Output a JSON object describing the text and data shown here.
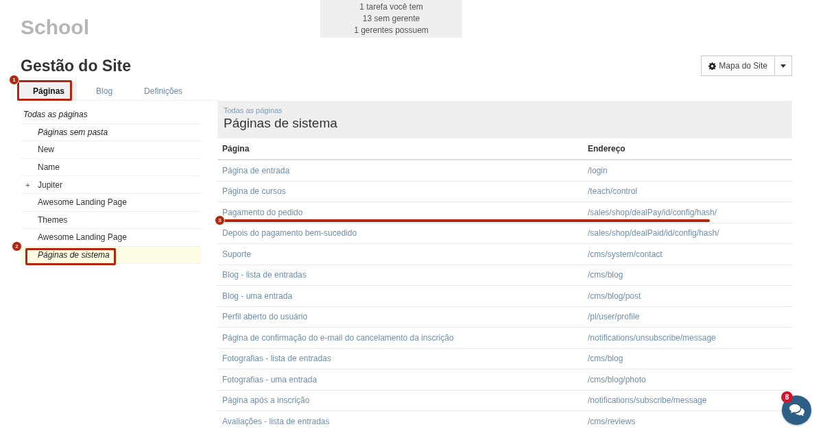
{
  "header": {
    "school": "School",
    "notifications": [
      "1 tarefa você tem",
      "13 sem gerente",
      "1 gerentes possuem"
    ]
  },
  "page_title": "Gestão do Site",
  "sitemap_button": {
    "label": "Mapa do Site"
  },
  "tabs": [
    {
      "label": "Páginas",
      "selected": true
    },
    {
      "label": "Blog",
      "selected": false
    },
    {
      "label": "Definições",
      "selected": false
    }
  ],
  "sidebar": {
    "items": [
      {
        "label": "Todas as páginas",
        "kind": "root",
        "selected": false
      },
      {
        "label": "Páginas sem pasta",
        "kind": "special",
        "selected": false
      },
      {
        "label": "New",
        "kind": "folder",
        "selected": false
      },
      {
        "label": "Name",
        "kind": "folder",
        "selected": false
      },
      {
        "label": "Jupiter",
        "kind": "folder",
        "toggle": "+",
        "selected": false
      },
      {
        "label": "Awesome Landing Page",
        "kind": "folder",
        "selected": false
      },
      {
        "label": "Themes",
        "kind": "folder",
        "selected": false
      },
      {
        "label": "Awesome Landing Page",
        "kind": "folder",
        "selected": false
      },
      {
        "label": "Páginas de sistema",
        "kind": "special",
        "selected": true
      }
    ]
  },
  "content": {
    "breadcrumb": "Todas as páginas",
    "title": "Páginas de sistema"
  },
  "table": {
    "columns": [
      "Página",
      "Endereço"
    ],
    "rows": [
      [
        "Página de entrada",
        "/login"
      ],
      [
        "Página de cursos",
        "/teach/control"
      ],
      [
        "Pagamento do pedido",
        "/sales/shop/dealPay/id/config/hash/"
      ],
      [
        "Depois do pagamento bem-sucedido",
        "/sales/shop/dealPaid/id/config/hash/"
      ],
      [
        "Suporte",
        "/cms/system/contact"
      ],
      [
        "Blog - lista de entradas",
        "/cms/blog"
      ],
      [
        "Blog - uma entrada",
        "/cms/blog/post"
      ],
      [
        "Perfil aberto do usuário",
        "/pl/user/profile"
      ],
      [
        "Página de confirmação do e-mail do cancelamento da inscrição",
        "/notifications/unsubscribe/message"
      ],
      [
        "Fotografias - lista de entradas",
        "/cms/blog"
      ],
      [
        "Fotografias - uma entrada",
        "/cms/blog/photo"
      ],
      [
        "Página após a inscrição",
        "/notifications/subscribe/message"
      ],
      [
        "Avaliações - lista de entradas",
        "/cms/reviews"
      ]
    ]
  },
  "annotations": [
    {
      "number": "1",
      "kind": "box"
    },
    {
      "number": "2",
      "kind": "box"
    },
    {
      "number": "3",
      "kind": "line"
    }
  ],
  "chat": {
    "badge": "8"
  }
}
